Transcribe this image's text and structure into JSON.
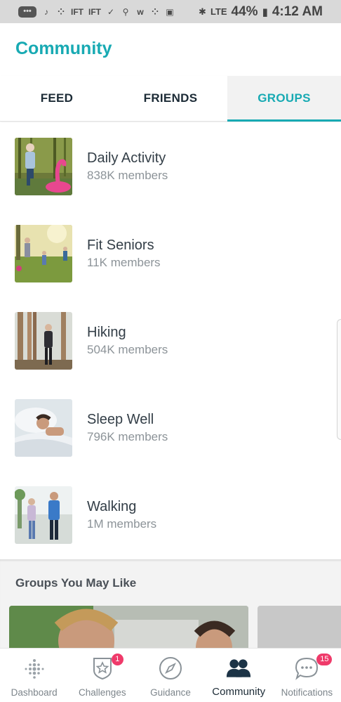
{
  "status_bar": {
    "icons": [
      "messages-icon",
      "music-icon",
      "fitbit-dots-icon",
      "ift-icon",
      "ift-icon",
      "check-icon",
      "fitness-icon",
      "wink-icon",
      "fitbit-dots-icon",
      "battery-saver-icon"
    ],
    "bluetooth": "✱",
    "signal": "LTE",
    "battery_percent": "44%",
    "time": "4:12 AM"
  },
  "header": {
    "title": "Community",
    "accent_color": "#18aab3"
  },
  "tabs": [
    {
      "label": "FEED",
      "active": false
    },
    {
      "label": "FRIENDS",
      "active": false
    },
    {
      "label": "GROUPS",
      "active": true
    }
  ],
  "groups": [
    {
      "name": "Daily Activity",
      "members": "838K members",
      "image": "senior-yoga-flamingo"
    },
    {
      "name": "Fit Seniors",
      "members": "11K members",
      "image": "family-soccer"
    },
    {
      "name": "Hiking",
      "members": "504K members",
      "image": "woman-in-forest"
    },
    {
      "name": "Sleep Well",
      "members": "796K members",
      "image": "man-sleeping"
    },
    {
      "name": "Walking",
      "members": "1M members",
      "image": "couple-walking"
    }
  ],
  "suggestions": {
    "title": "Groups You May Like"
  },
  "bottom_nav": [
    {
      "label": "Dashboard",
      "icon": "fitbit-dots-icon",
      "badge": null,
      "active": false
    },
    {
      "label": "Challenges",
      "icon": "star-shield-icon",
      "badge": "1",
      "active": false
    },
    {
      "label": "Guidance",
      "icon": "compass-icon",
      "badge": null,
      "active": false
    },
    {
      "label": "Community",
      "icon": "people-icon",
      "badge": null,
      "active": true
    },
    {
      "label": "Notifications",
      "icon": "chat-bubble-icon",
      "badge": "15",
      "active": false
    }
  ]
}
